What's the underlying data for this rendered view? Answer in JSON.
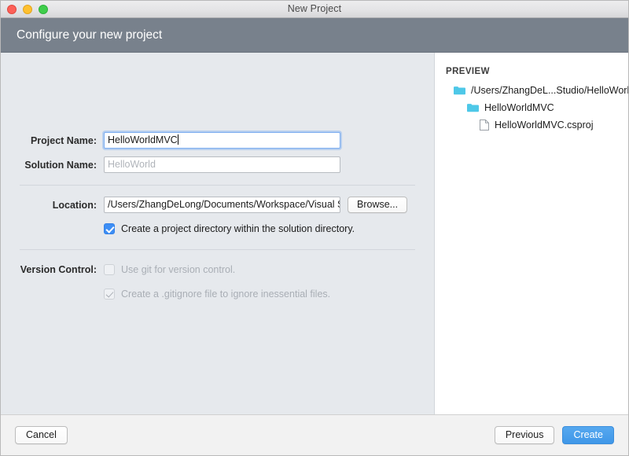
{
  "window": {
    "title": "New Project",
    "traffic_lights": [
      "close-button",
      "minimize-button",
      "maximize-button"
    ]
  },
  "header": {
    "title": "Configure your new project"
  },
  "form": {
    "project_name": {
      "label": "Project Name:",
      "value": "HelloWorldMVC",
      "focused": true
    },
    "solution_name": {
      "label": "Solution Name:",
      "value": "",
      "placeholder": "HelloWorld"
    },
    "location": {
      "label": "Location:",
      "value": "/Users/ZhangDeLong/Documents/Workspace/Visual Studi",
      "browse_label": "Browse..."
    },
    "create_project_directory": {
      "label": "Create a project directory within the solution directory.",
      "checked": true,
      "enabled": true
    },
    "version_control": {
      "label": "Version Control:",
      "use_git": {
        "label": "Use git for version control.",
        "checked": false,
        "enabled": false
      },
      "gitignore": {
        "label": "Create a .gitignore file to ignore inessential files.",
        "checked": true,
        "enabled": false
      }
    }
  },
  "preview": {
    "heading": "PREVIEW",
    "tree": [
      {
        "label": "/Users/ZhangDeL...Studio/HelloWorld",
        "icon": "folder-icon",
        "level": 1
      },
      {
        "label": "HelloWorldMVC",
        "icon": "folder-icon",
        "level": 2
      },
      {
        "label": "HelloWorldMVC.csproj",
        "icon": "file-icon",
        "level": 3
      }
    ]
  },
  "footer": {
    "cancel_label": "Cancel",
    "previous_label": "Previous",
    "create_label": "Create"
  },
  "colors": {
    "header_band": "#78818c",
    "form_background": "#e6e9ed",
    "accent_blue": "#3d8ef5",
    "primary_button": "#4a9fe8",
    "folder_icon": "#4ec8e8"
  }
}
